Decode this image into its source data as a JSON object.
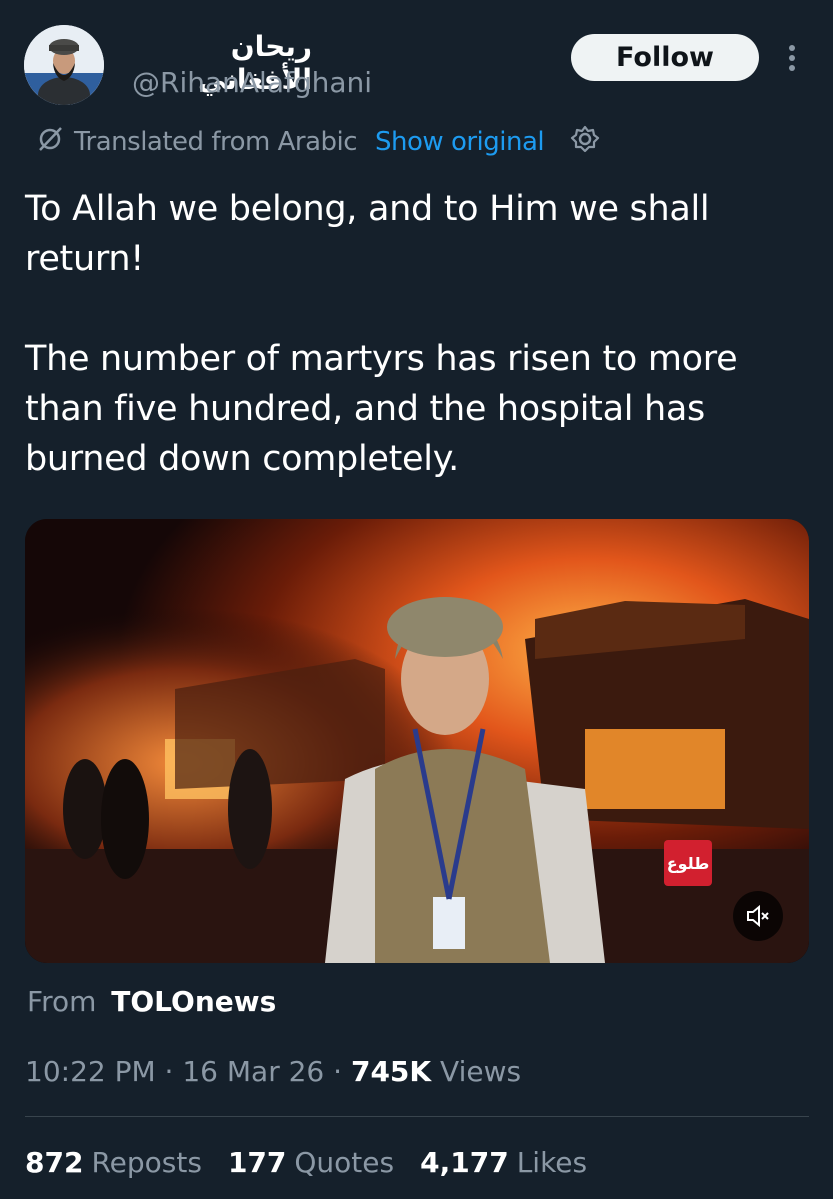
{
  "author": {
    "display_name": "ريحان الأفغاني",
    "handle": "@RihanAlafghani",
    "follow_label": "Follow"
  },
  "translation": {
    "label": "Translated from Arabic",
    "show_original": "Show original"
  },
  "tweet": {
    "text": "To Allah we belong, and to Him we shall\nreturn!\n\nThe number of martyrs has risen to more\nthan five hundred, and the hospital has\nburned down completely."
  },
  "media": {
    "channel_logo_text": "طلوع"
  },
  "source": {
    "from_label": "From",
    "name": "TOLOnews"
  },
  "meta": {
    "time": "10:22 PM",
    "date": "16 Mar 26",
    "views_count": "745K",
    "views_label": "Views",
    "separator": "·"
  },
  "stats": {
    "reposts_count": "872",
    "reposts_label": "Reposts",
    "quotes_count": "177",
    "quotes_label": "Quotes",
    "likes_count": "4,177",
    "likes_label": "Likes"
  },
  "icons": {
    "translate": "translate-icon",
    "settings": "gear-icon",
    "more": "more-vertical-icon",
    "mute": "speaker-muted-icon"
  },
  "colors": {
    "background": "#15202b",
    "link": "#1d9bf0",
    "secondary_text": "#8b98a5",
    "follow_button": "#eff3f4"
  }
}
